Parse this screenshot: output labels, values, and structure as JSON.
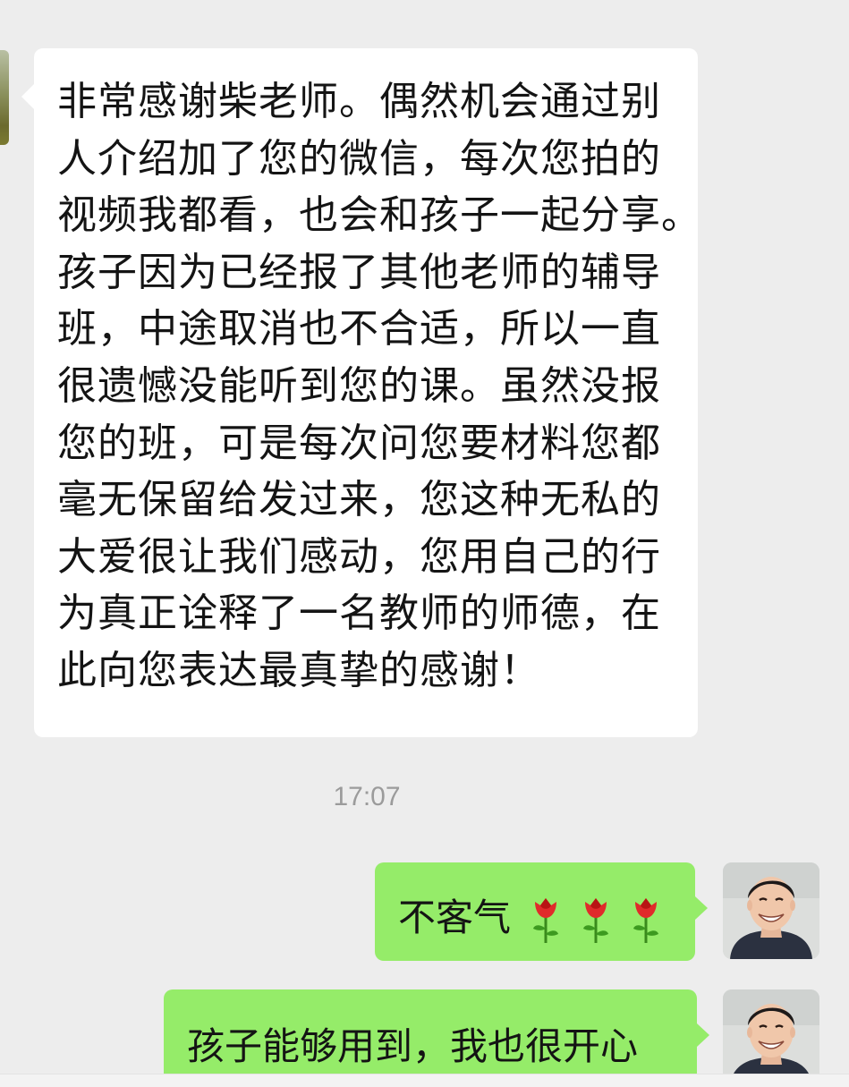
{
  "chat": {
    "incoming": {
      "lines": [
        "非常感谢柴老师。偶然机会通过别",
        "人介绍加了您的微信，每次您拍的",
        "视频我都看，也会和孩子一起分享。",
        "孩子因为已经报了其他老师的辅导",
        "班，中途取消也不合适，所以一直",
        "很遗憾没能听到您的课。虽然没报",
        "您的班，可是每次问您要材料您都",
        "毫无保留给发过来，您这种无私的",
        "大爱很让我们感动，您用自己的行",
        "为真正诠释了一名教师的师德，在",
        "此向您表达最真挚的感谢！"
      ]
    },
    "timestamp": "17:07",
    "outgoing": [
      {
        "text": "不客气",
        "emoji": [
          "rose",
          "rose",
          "rose"
        ]
      },
      {
        "text": "孩子能够用到，我也很开心"
      }
    ]
  },
  "colors": {
    "background": "#ededed",
    "incoming_bubble": "#ffffff",
    "outgoing_bubble": "#95ec69",
    "timestamp": "#9b9b9b"
  }
}
